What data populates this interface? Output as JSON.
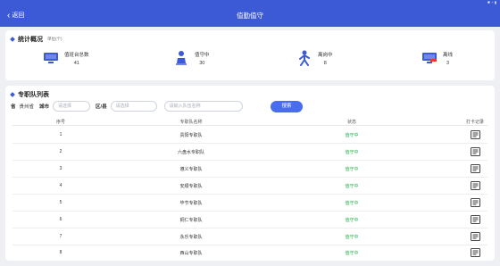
{
  "header": {
    "back_label": "返回",
    "title": "值勤值守"
  },
  "stats": {
    "title": "统计概况",
    "subtitle": "单位(个)",
    "items": [
      {
        "label": "值班台总数",
        "value": "41",
        "icon": "monitor-icon"
      },
      {
        "label": "值守中",
        "value": "30",
        "icon": "person-seated-icon"
      },
      {
        "label": "离岗中",
        "value": "8",
        "icon": "person-walking-icon"
      },
      {
        "label": "离线",
        "value": "3",
        "icon": "monitor-offline-icon"
      }
    ]
  },
  "list": {
    "title": "专职队列表",
    "province_label": "省",
    "province_value": "贵州省",
    "city_label": "城市",
    "city_placeholder": "请选择",
    "district_label": "区/县",
    "district_placeholder": "请选择",
    "keyword_placeholder": "请输入队伍名称",
    "search_label": "搜索",
    "columns": [
      "序号",
      "专职队名称",
      "状态",
      "打卡记录"
    ],
    "rows": [
      {
        "no": "1",
        "name": "贵阳专职队",
        "status": "值守中"
      },
      {
        "no": "2",
        "name": "六盘水专职队",
        "status": "值守中"
      },
      {
        "no": "3",
        "name": "遵义专职队",
        "status": "值守中"
      },
      {
        "no": "4",
        "name": "安顺专职队",
        "status": "值守中"
      },
      {
        "no": "5",
        "name": "毕节专职队",
        "status": "值守中"
      },
      {
        "no": "6",
        "name": "铜仁专职队",
        "status": "值守中"
      },
      {
        "no": "7",
        "name": "永乐专职队",
        "status": "值守中"
      },
      {
        "no": "8",
        "name": "西山专职队",
        "status": "值守中"
      }
    ]
  },
  "colors": {
    "primary": "#3d5ad6",
    "button": "#4a6cf0",
    "status_on": "#23b34a",
    "offline_accent": "#e53935"
  }
}
